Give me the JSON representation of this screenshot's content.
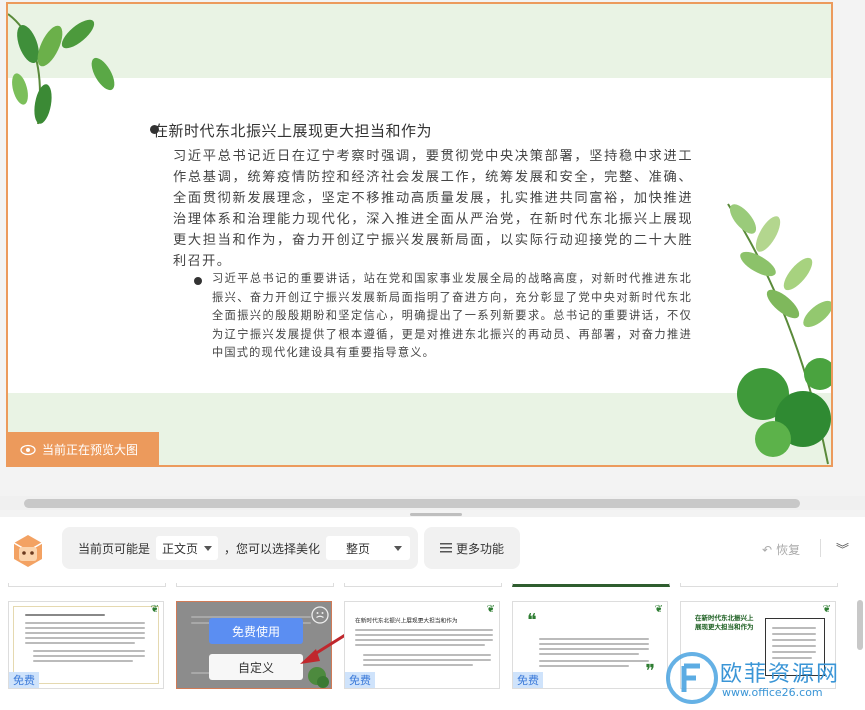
{
  "slide": {
    "heading": "在新时代东北振兴上展现更大担当和作为",
    "paragraph": "习近平总书记近日在辽宁考察时强调，要贯彻党中央决策部署，坚持稳中求进工作总基调，统筹疫情防控和经济社会发展工作，统筹发展和安全，完整、准确、全面贯彻新发展理念，坚定不移推动高质量发展，扎实推进共同富裕，加快推进治理体系和治理能力现代化，深入推进全面从严治党，在新时代东北振兴上展现更大担当和作为，奋力开创辽宁振兴发展新局面，以实际行动迎接党的二十大胜利召开。",
    "subparagraph": "习近平总书记的重要讲话，站在党和国家事业发展全局的战略高度，对新时代推进东北振兴、奋力开创辽宁振兴发展新局面指明了奋进方向，充分彰显了党中央对新时代东北全面振兴的殷殷期盼和坚定信心，明确提出了一系列新要求。总书记的重要讲话，不仅为辽宁振兴发展提供了根本遵循，更是对推进东北振兴的再动员、再部署，对奋力推进中国式的现代化建设具有重要指导意义。",
    "preview_badge": "当前正在预览大图",
    "colors": {
      "accent": "#ec9a5c",
      "band": "#e9f3e4",
      "leaf": "#3f8f3a"
    }
  },
  "toolbar": {
    "prefix": "当前页可能是",
    "page_type": "正文页",
    "middle": "，您可以选择美化",
    "scope": "整页",
    "more": "更多功能",
    "restore": "恢复"
  },
  "thumbs": {
    "free_label": "免费",
    "use_free_button": "免费使用",
    "customize_button": "自定义",
    "card3_title": "在新时代东北振兴上展现更大担当和作为",
    "card5_title": "在新时代东北振兴上展现更大担当和作为",
    "quote_open": "❝",
    "quote_close": "❞"
  },
  "watermark": {
    "name": "欧菲资源网",
    "url": "www.office26.com"
  }
}
